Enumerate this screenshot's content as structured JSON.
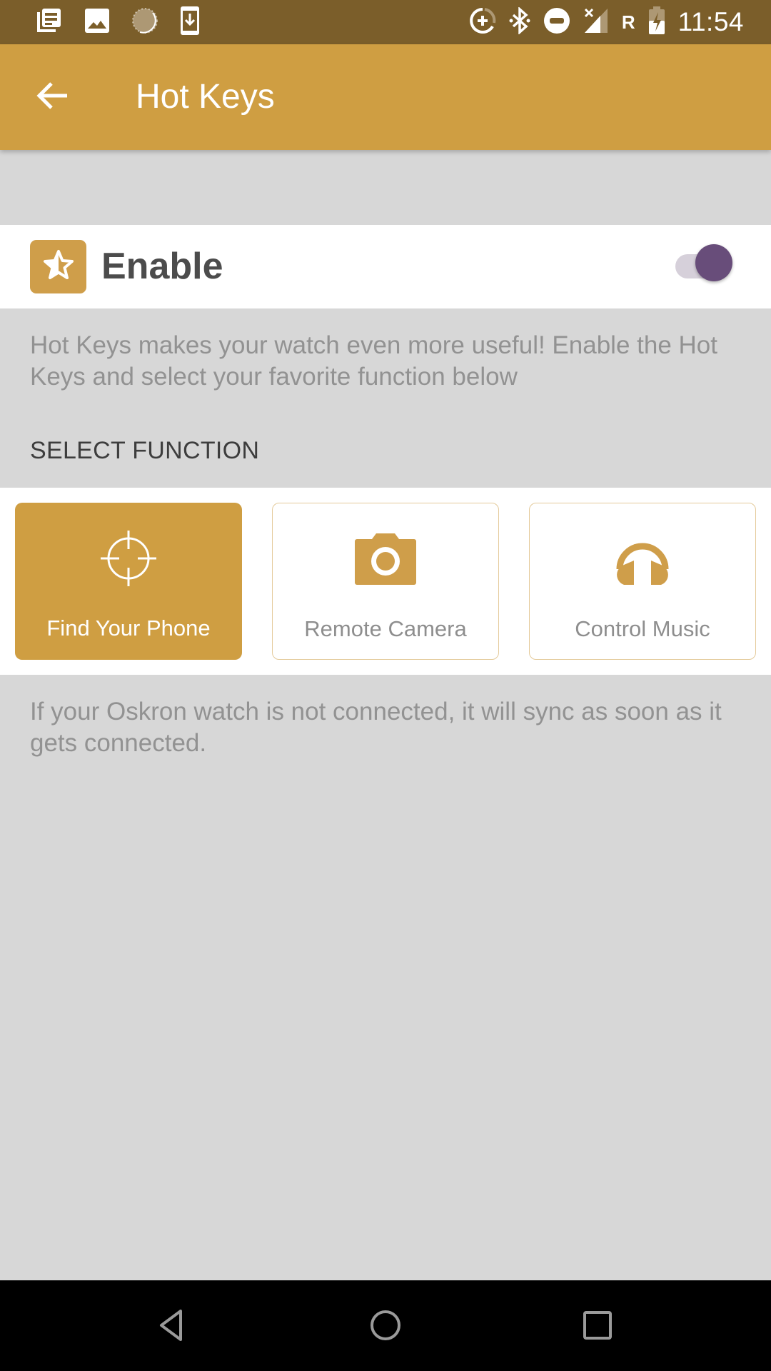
{
  "status_bar": {
    "left_icons": [
      "news-notification-icon",
      "image-notification-icon",
      "sync-spinner-icon",
      "download-notification-icon"
    ],
    "right_icons": [
      "data-saver-icon",
      "bluetooth-icon",
      "do-not-disturb-icon",
      "no-signal-icon",
      "roaming-indicator",
      "battery-charging-icon"
    ],
    "roaming_label": "R",
    "time": "11:54"
  },
  "app_bar": {
    "title": "Hot Keys",
    "back_icon": "arrow-left-icon"
  },
  "enable_setting": {
    "label": "Enable",
    "icon": "star-icon",
    "enabled": true
  },
  "description": "Hot Keys makes your watch even more useful! Enable the Hot Keys and select your favorite function below",
  "select_function": {
    "header": "SELECT FUNCTION",
    "options": [
      {
        "label": "Find Your Phone",
        "icon": "crosshair-icon",
        "selected": true
      },
      {
        "label": "Remote Camera",
        "icon": "camera-icon",
        "selected": false
      },
      {
        "label": "Control Music",
        "icon": "headphones-icon",
        "selected": false
      }
    ]
  },
  "footer_note": "If your Oskron watch is not connected, it will sync as soon as it gets connected.",
  "colors": {
    "status_bar": "#7b5e2a",
    "primary": "#cf9e42",
    "toggle_thumb": "#684d7a",
    "background": "#d7d7d7"
  },
  "nav_bar": {
    "buttons": [
      "back",
      "home",
      "recents"
    ]
  }
}
